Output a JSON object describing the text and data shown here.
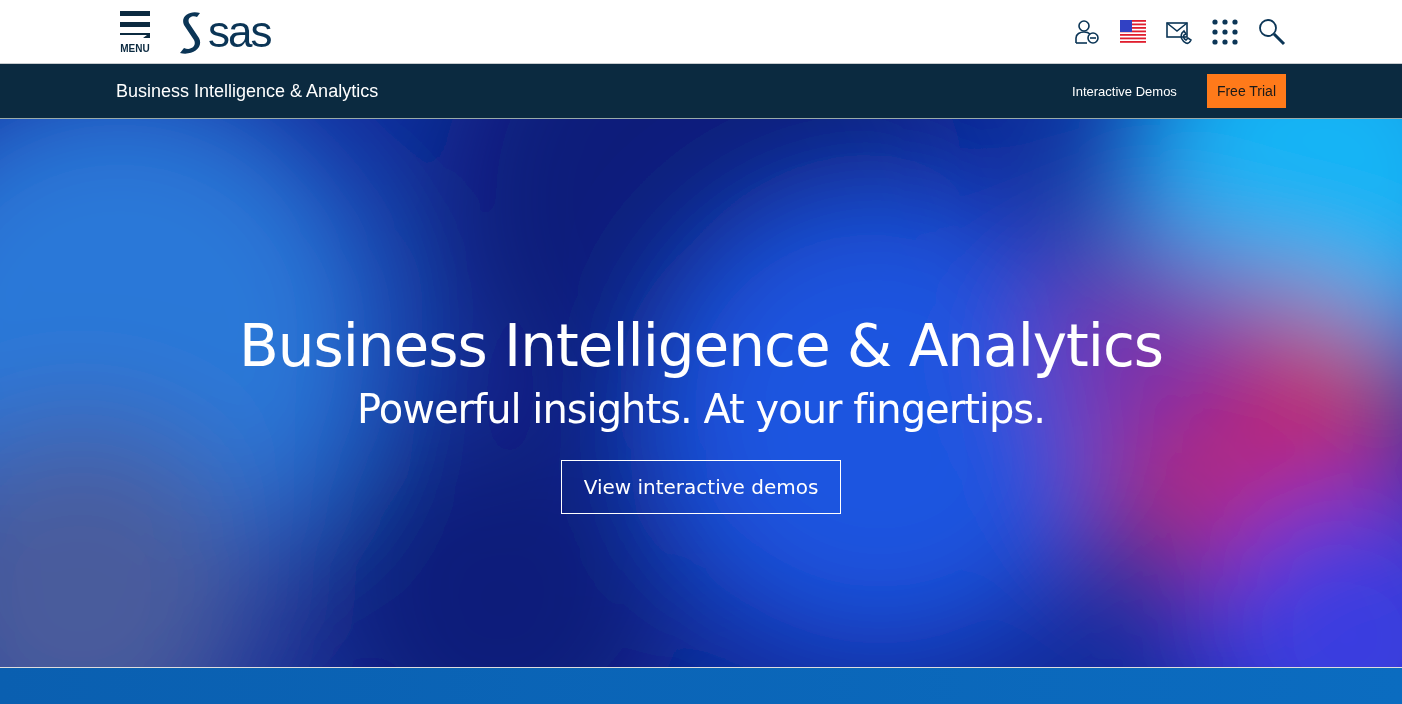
{
  "header": {
    "menu_label": "MENU",
    "logo_text": "sas"
  },
  "subnav": {
    "title": "Business Intelligence & Analytics",
    "link": "Interactive Demos",
    "cta": "Free Trial"
  },
  "hero": {
    "kind": "picture",
    "title": "Business Intelligence & Analytics",
    "subtitle": "Powerful insights. At your fingertips.",
    "button": "View interactive demos"
  }
}
